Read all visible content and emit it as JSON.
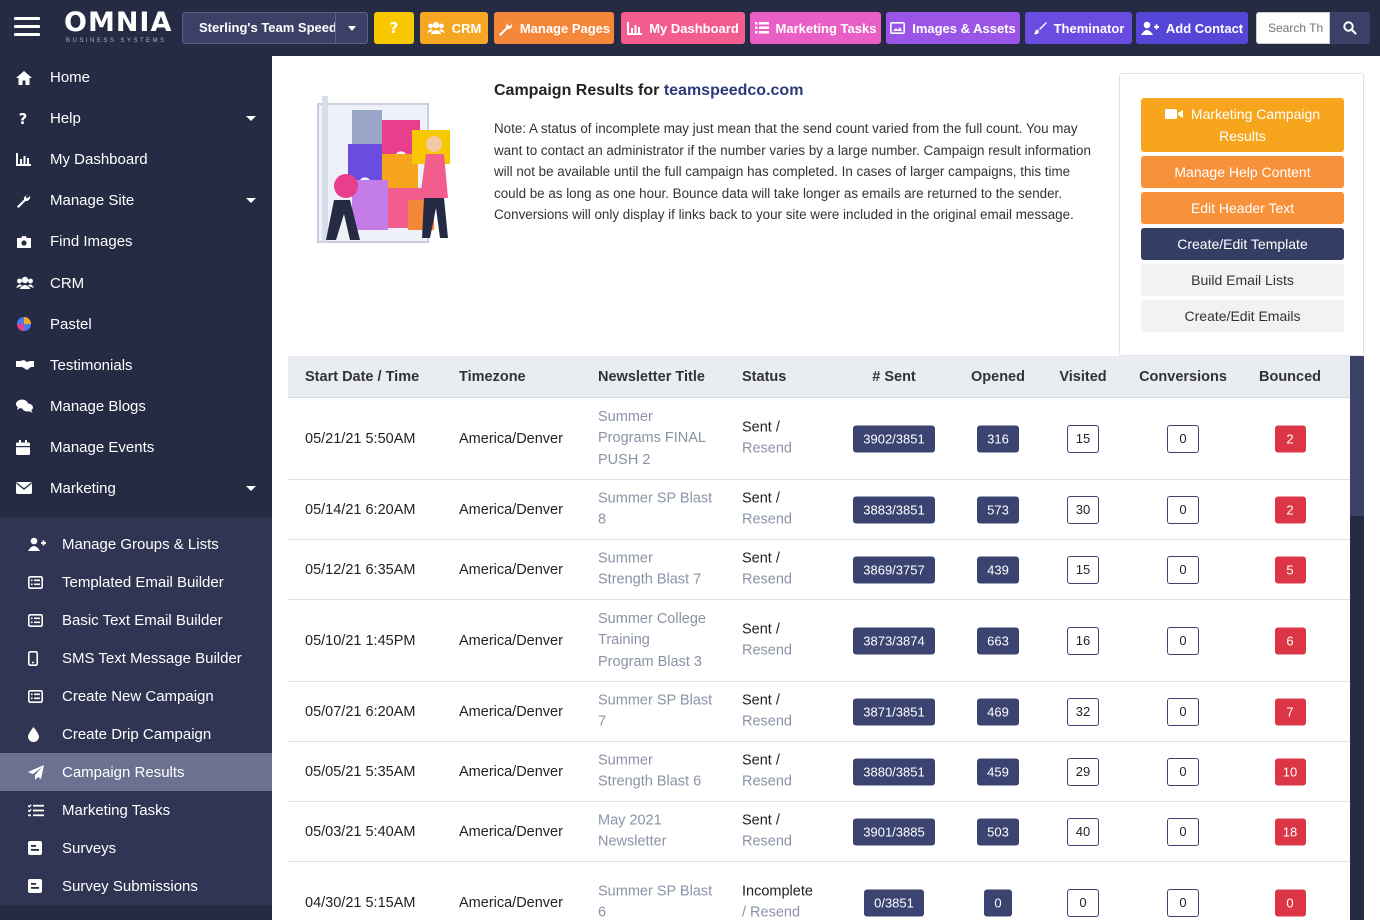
{
  "app": {
    "logo": "OMNIA",
    "logo_sub": "BUSINESS SYSTEMS",
    "team": "Sterling's Team Speed",
    "search_placeholder": "Search Th"
  },
  "toolbar": [
    {
      "label": "",
      "icon": "question-icon",
      "color": "#f7c700"
    },
    {
      "label": "CRM",
      "icon": "users-icon",
      "color": "#f5a623"
    },
    {
      "label": "Manage Pages",
      "icon": "wrench-icon",
      "color": "#f5873a"
    },
    {
      "label": "My Dashboard",
      "icon": "chart-icon",
      "color": "#f25d8e"
    },
    {
      "label": "Marketing Tasks",
      "icon": "list-icon",
      "color": "#ea5fc5"
    },
    {
      "label": "Images & Assets",
      "icon": "image-icon",
      "color": "#9a55e6"
    },
    {
      "label": "Theminator",
      "icon": "brush-icon",
      "color": "#6a4ce0"
    },
    {
      "label": "Add Contact",
      "icon": "user-plus-icon",
      "color": "#5546d8"
    }
  ],
  "sidebar": {
    "items": [
      {
        "label": "Home",
        "icon": "home-icon",
        "chevron": false
      },
      {
        "label": "Help",
        "icon": "question-icon",
        "chevron": true
      },
      {
        "label": "My Dashboard",
        "icon": "chart-icon",
        "chevron": false
      },
      {
        "label": "Manage Site",
        "icon": "wrench-icon",
        "chevron": true
      },
      {
        "label": "Find Images",
        "icon": "camera-icon",
        "chevron": false
      },
      {
        "label": "CRM",
        "icon": "users-icon",
        "chevron": false
      },
      {
        "label": "Pastel",
        "icon": "pastel-icon",
        "chevron": false
      },
      {
        "label": "Testimonials",
        "icon": "handshake-icon",
        "chevron": false
      },
      {
        "label": "Manage Blogs",
        "icon": "comments-icon",
        "chevron": false
      },
      {
        "label": "Manage Events",
        "icon": "calendar-icon",
        "chevron": false
      },
      {
        "label": "Marketing",
        "icon": "envelope-icon",
        "chevron": true
      }
    ],
    "sub_items": [
      {
        "label": "Manage Groups & Lists",
        "icon": "user-plus-icon",
        "active": false
      },
      {
        "label": "Templated Email Builder",
        "icon": "list-alt-icon",
        "active": false
      },
      {
        "label": "Basic Text Email Builder",
        "icon": "list-alt-icon",
        "active": false
      },
      {
        "label": "SMS Text Message Builder",
        "icon": "mobile-icon",
        "active": false
      },
      {
        "label": "Create New Campaign",
        "icon": "list-alt-icon",
        "active": false
      },
      {
        "label": "Create Drip Campaign",
        "icon": "drop-icon",
        "active": false
      },
      {
        "label": "Campaign Results",
        "icon": "paper-plane-icon",
        "active": true
      },
      {
        "label": "Marketing Tasks",
        "icon": "tasks-icon",
        "active": false
      },
      {
        "label": "Surveys",
        "icon": "poll-icon",
        "active": false
      },
      {
        "label": "Survey Submissions",
        "icon": "poll-icon",
        "active": false
      }
    ]
  },
  "intro": {
    "title_prefix": "Campaign Results for ",
    "domain": "teamspeedco.com",
    "note": "Note: A status of incomplete may just mean that the send count varied from the full count. You may want to contact an administrator if the number varies by a large number. Campaign result information will not be available until the full campaign has completed. In cases of larger campaigns, this time could be as long as one hour. Bounce data will take longer as emails are returned to the sender. Conversions will only display if links back to your site were included in the original email message."
  },
  "right_panel": {
    "buttons": [
      {
        "label": "Marketing Campaign Results",
        "icon": "video-icon",
        "bg": "#f7a51d"
      },
      {
        "label": "Manage Help Content",
        "icon": "",
        "bg": "#f7913a"
      },
      {
        "label": "Edit Header Text",
        "icon": "",
        "bg": "#f7913a"
      },
      {
        "label": "Create/Edit Template",
        "icon": "",
        "bg": "#343d63"
      },
      {
        "label": "Build Email Lists",
        "icon": "",
        "bg": "#f1f2f4"
      },
      {
        "label": "Create/Edit Emails",
        "icon": "",
        "bg": "#f1f2f4"
      }
    ]
  },
  "table": {
    "headers": [
      "Start Date / Time",
      "Timezone",
      "Newsletter Title",
      "Status",
      "# Sent",
      "Opened",
      "Visited",
      "Conversions",
      "Bounced"
    ],
    "rows": [
      {
        "date": "05/21/21 5:50AM",
        "tz": "America/Denver",
        "title": [
          "Summer",
          "Programs FINAL",
          "PUSH 2"
        ],
        "status": "Sent /",
        "resend": "Resend",
        "sent": "3902/3851",
        "opened": "316",
        "visited": "15",
        "conversions": "0",
        "bounced": "2"
      },
      {
        "date": "05/14/21 6:20AM",
        "tz": "America/Denver",
        "title": [
          "Summer SP Blast",
          "8"
        ],
        "status": "Sent /",
        "resend": "Resend",
        "sent": "3883/3851",
        "opened": "573",
        "visited": "30",
        "conversions": "0",
        "bounced": "2"
      },
      {
        "date": "05/12/21 6:35AM",
        "tz": "America/Denver",
        "title": [
          "Summer",
          "Strength Blast 7"
        ],
        "status": "Sent /",
        "resend": "Resend",
        "sent": "3869/3757",
        "opened": "439",
        "visited": "15",
        "conversions": "0",
        "bounced": "5"
      },
      {
        "date": "05/10/21 1:45PM",
        "tz": "America/Denver",
        "title": [
          "Summer College",
          "Training",
          "Program Blast 3"
        ],
        "status": "Sent /",
        "resend": "Resend",
        "sent": "3873/3874",
        "opened": "663",
        "visited": "16",
        "conversions": "0",
        "bounced": "6"
      },
      {
        "date": "05/07/21 6:20AM",
        "tz": "America/Denver",
        "title": [
          "Summer SP Blast",
          "7"
        ],
        "status": "Sent /",
        "resend": "Resend",
        "sent": "3871/3851",
        "opened": "469",
        "visited": "32",
        "conversions": "0",
        "bounced": "7"
      },
      {
        "date": "05/05/21 5:35AM",
        "tz": "America/Denver",
        "title": [
          "Summer",
          "Strength Blast 6"
        ],
        "status": "Sent /",
        "resend": "Resend",
        "sent": "3880/3851",
        "opened": "459",
        "visited": "29",
        "conversions": "0",
        "bounced": "10"
      },
      {
        "date": "05/03/21 5:40AM",
        "tz": "America/Denver",
        "title": [
          "May 2021",
          "Newsletter"
        ],
        "status": "Sent /",
        "resend": "Resend",
        "sent": "3901/3885",
        "opened": "503",
        "visited": "40",
        "conversions": "0",
        "bounced": "18"
      },
      {
        "date": "04/30/21 5:15AM",
        "tz": "America/Denver",
        "title": [
          "Summer SP Blast",
          "6"
        ],
        "status": "Incomplete",
        "resend": "/ Resend",
        "sent": "0/3851",
        "opened": "0",
        "visited": "0",
        "conversions": "0",
        "bounced": "0"
      }
    ]
  }
}
